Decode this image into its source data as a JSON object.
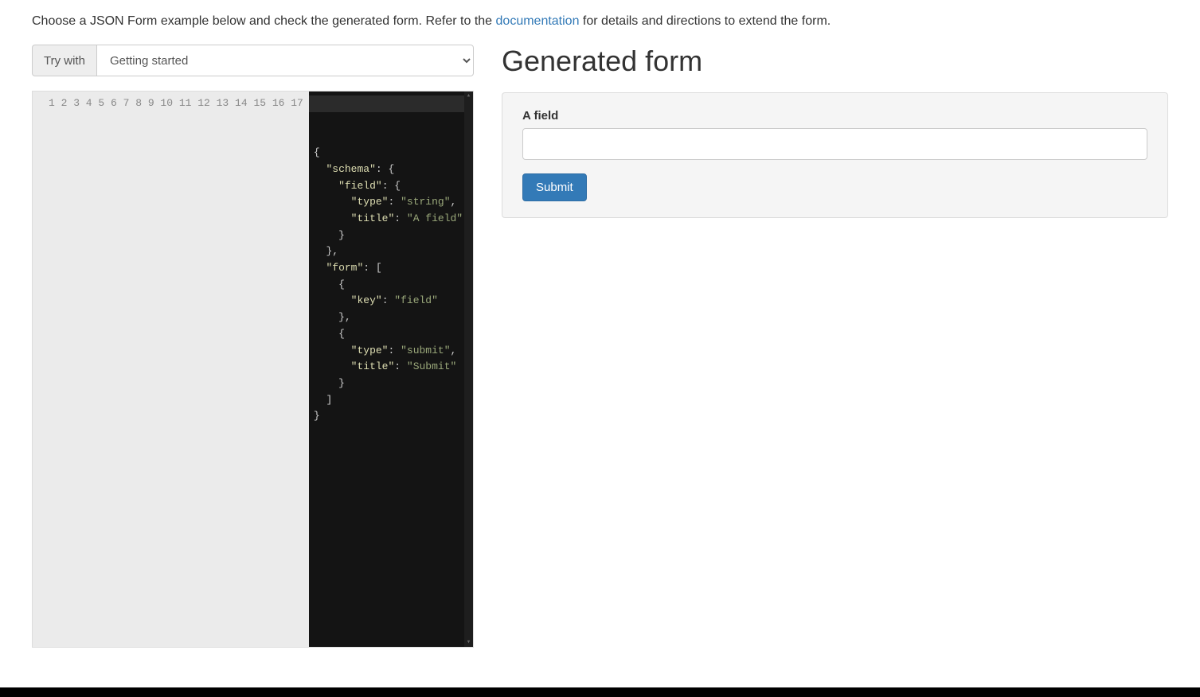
{
  "intro": {
    "text_before": "Choose a JSON Form example below and check the generated form. Refer to the ",
    "link_text": "documentation",
    "text_after": " for details and directions to extend the form."
  },
  "selector": {
    "addon_label": "Try with",
    "selected": "Getting started"
  },
  "editor": {
    "line_count": 17,
    "tokens": [
      [
        {
          "t": "punc",
          "v": "{"
        }
      ],
      [
        {
          "t": "indent",
          "v": "  "
        },
        {
          "t": "key",
          "v": "\"schema\""
        },
        {
          "t": "punc",
          "v": ": {"
        }
      ],
      [
        {
          "t": "indent",
          "v": "    "
        },
        {
          "t": "key",
          "v": "\"field\""
        },
        {
          "t": "punc",
          "v": ": {"
        }
      ],
      [
        {
          "t": "indent",
          "v": "      "
        },
        {
          "t": "key",
          "v": "\"type\""
        },
        {
          "t": "punc",
          "v": ": "
        },
        {
          "t": "str",
          "v": "\"string\""
        },
        {
          "t": "punc",
          "v": ","
        }
      ],
      [
        {
          "t": "indent",
          "v": "      "
        },
        {
          "t": "key",
          "v": "\"title\""
        },
        {
          "t": "punc",
          "v": ": "
        },
        {
          "t": "str",
          "v": "\"A field\""
        }
      ],
      [
        {
          "t": "indent",
          "v": "    "
        },
        {
          "t": "punc",
          "v": "}"
        }
      ],
      [
        {
          "t": "indent",
          "v": "  "
        },
        {
          "t": "punc",
          "v": "},"
        }
      ],
      [
        {
          "t": "indent",
          "v": "  "
        },
        {
          "t": "key",
          "v": "\"form\""
        },
        {
          "t": "punc",
          "v": ": ["
        }
      ],
      [
        {
          "t": "indent",
          "v": "    "
        },
        {
          "t": "punc",
          "v": "{"
        }
      ],
      [
        {
          "t": "indent",
          "v": "      "
        },
        {
          "t": "key",
          "v": "\"key\""
        },
        {
          "t": "punc",
          "v": ": "
        },
        {
          "t": "str",
          "v": "\"field\""
        }
      ],
      [
        {
          "t": "indent",
          "v": "    "
        },
        {
          "t": "punc",
          "v": "},"
        }
      ],
      [
        {
          "t": "indent",
          "v": "    "
        },
        {
          "t": "punc",
          "v": "{"
        }
      ],
      [
        {
          "t": "indent",
          "v": "      "
        },
        {
          "t": "key",
          "v": "\"type\""
        },
        {
          "t": "punc",
          "v": ": "
        },
        {
          "t": "str",
          "v": "\"submit\""
        },
        {
          "t": "punc",
          "v": ","
        }
      ],
      [
        {
          "t": "indent",
          "v": "      "
        },
        {
          "t": "key",
          "v": "\"title\""
        },
        {
          "t": "punc",
          "v": ": "
        },
        {
          "t": "str",
          "v": "\"Submit\""
        }
      ],
      [
        {
          "t": "indent",
          "v": "    "
        },
        {
          "t": "punc",
          "v": "}"
        }
      ],
      [
        {
          "t": "indent",
          "v": "  "
        },
        {
          "t": "punc",
          "v": "]"
        }
      ],
      [
        {
          "t": "punc",
          "v": "}"
        }
      ]
    ]
  },
  "generated": {
    "heading": "Generated form",
    "field_label": "A field",
    "field_value": "",
    "submit_label": "Submit"
  }
}
